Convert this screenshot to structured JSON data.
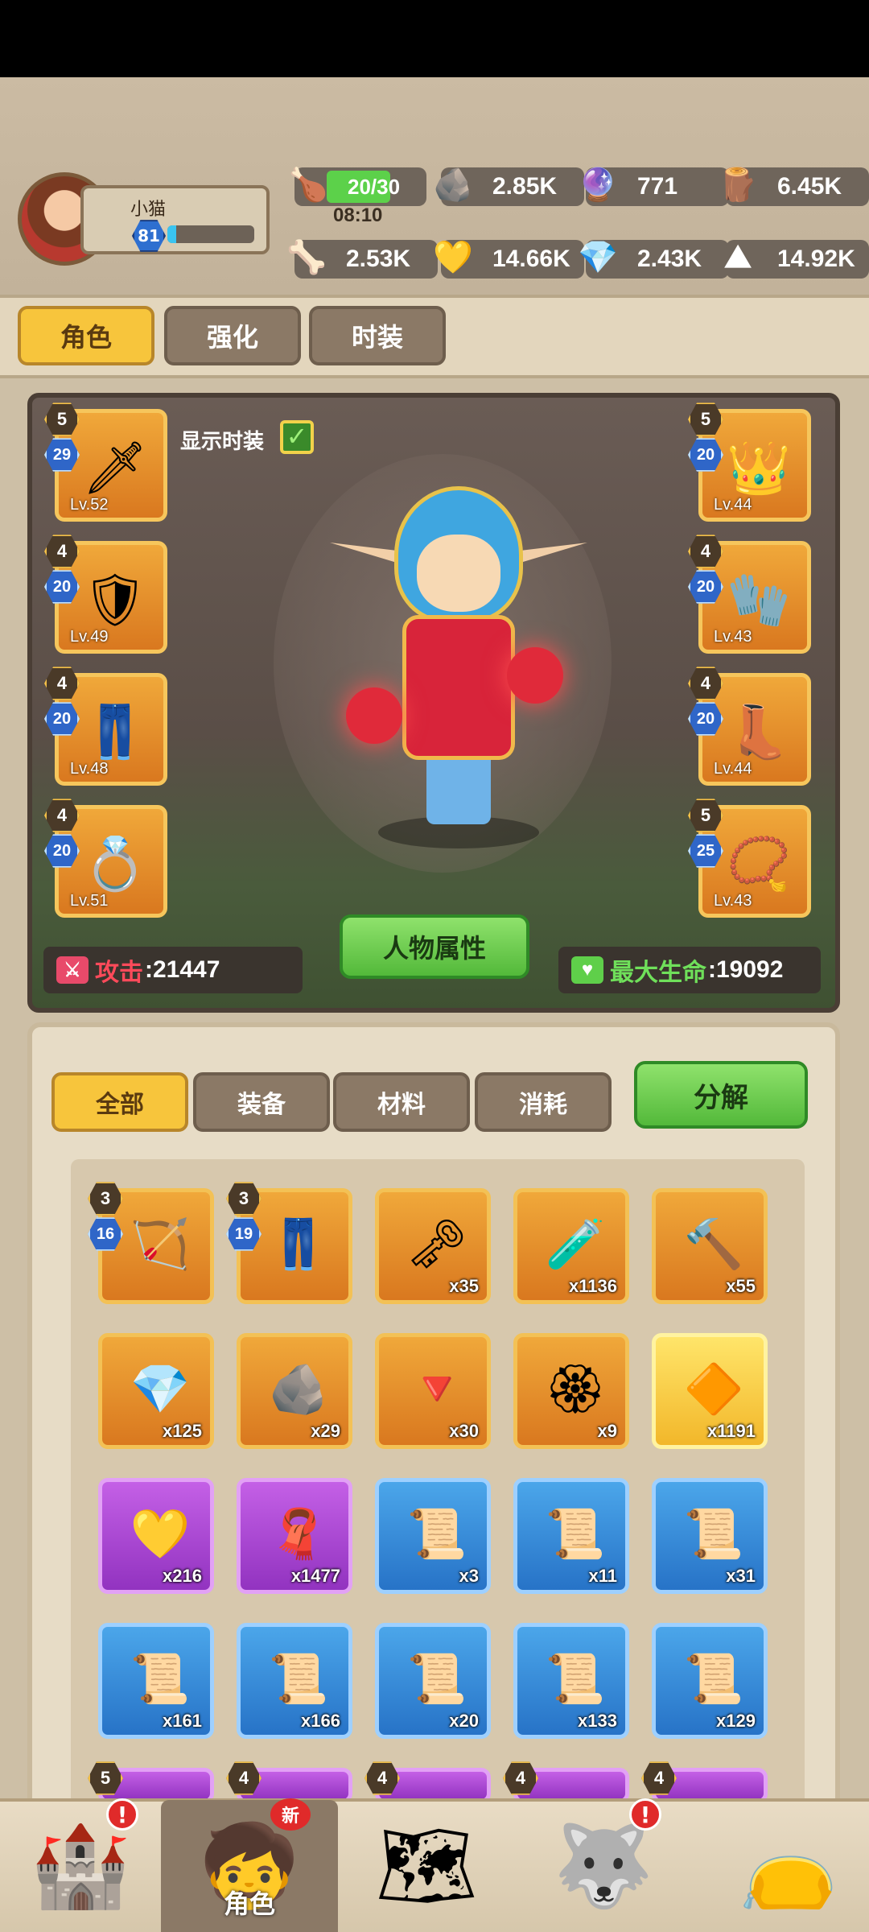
{
  "player": {
    "name": "小猫",
    "level": "81",
    "xp_fraction": 0.1
  },
  "resources": {
    "stamina": {
      "value": "20/30",
      "timer": "08:10",
      "fill": 0.66
    },
    "stone_plus": "2.85K",
    "purple_orb": "771",
    "wood": "6.45K",
    "bone": "2.53K",
    "gold_ore": "14.66K",
    "crystal": "2.43K",
    "iron": "14.92K"
  },
  "tabs": [
    "角色",
    "强化",
    "时装"
  ],
  "character": {
    "show_costume_label": "显示时装",
    "attack_label": "攻击",
    "attack_value": ":21447",
    "hp_label": "最大生命",
    "hp_value": ":19092",
    "attributes_button": "人物属性"
  },
  "equipment_left": [
    {
      "stars": "5",
      "level_badge": "29",
      "lv": "Lv.52",
      "icon": "weapon-icon"
    },
    {
      "stars": "4",
      "level_badge": "20",
      "lv": "Lv.49",
      "icon": "shoulder-armor-icon"
    },
    {
      "stars": "4",
      "level_badge": "20",
      "lv": "Lv.48",
      "icon": "leg-armor-icon"
    },
    {
      "stars": "4",
      "level_badge": "20",
      "lv": "Lv.51",
      "icon": "ring-icon"
    }
  ],
  "equipment_right": [
    {
      "stars": "5",
      "level_badge": "20",
      "lv": "Lv.44",
      "icon": "spiked-crown-icon"
    },
    {
      "stars": "4",
      "level_badge": "20",
      "lv": "Lv.43",
      "icon": "gauntlet-icon"
    },
    {
      "stars": "4",
      "level_badge": "20",
      "lv": "Lv.44",
      "icon": "boots-icon"
    },
    {
      "stars": "5",
      "level_badge": "25",
      "lv": "Lv.43",
      "icon": "necklace-icon"
    }
  ],
  "inventory": {
    "tabs": [
      "全部",
      "装备",
      "材料",
      "消耗"
    ],
    "decompose_button": "分解",
    "items": [
      {
        "color": "orange",
        "stars": "3",
        "level_badge": "16",
        "count": "",
        "icon": "crossbow-icon"
      },
      {
        "color": "orange",
        "stars": "3",
        "level_badge": "19",
        "count": "",
        "icon": "pants-icon"
      },
      {
        "color": "orange",
        "count": "x35",
        "icon": "key-wand-icon"
      },
      {
        "color": "orange",
        "count": "x1136",
        "icon": "potion-jar-icon"
      },
      {
        "color": "orange",
        "count": "x55",
        "icon": "hammer-icon"
      },
      {
        "color": "orange",
        "count": "x125",
        "icon": "blue-crystal-icon"
      },
      {
        "color": "orange",
        "count": "x29",
        "icon": "rune-stone-icon"
      },
      {
        "color": "orange",
        "count": "x30",
        "icon": "red-crystal-icon"
      },
      {
        "color": "orange",
        "count": "x9",
        "icon": "emblem-icon"
      },
      {
        "color": "gold",
        "count": "x1191",
        "icon": "gold-pile-icon"
      },
      {
        "color": "purple",
        "count": "x216",
        "icon": "gold-heart-icon"
      },
      {
        "color": "purple",
        "count": "x1477",
        "icon": "cloth-icon"
      },
      {
        "color": "blue",
        "count": "x3",
        "icon": "scroll-icon"
      },
      {
        "color": "blue",
        "count": "x11",
        "icon": "scroll-icon"
      },
      {
        "color": "blue",
        "count": "x31",
        "icon": "scroll-icon"
      },
      {
        "color": "blue",
        "count": "x161",
        "icon": "scroll-icon"
      },
      {
        "color": "blue",
        "count": "x166",
        "icon": "scroll-icon"
      },
      {
        "color": "blue",
        "count": "x20",
        "icon": "scroll-icon"
      },
      {
        "color": "blue",
        "count": "x133",
        "icon": "scroll-icon"
      },
      {
        "color": "blue",
        "count": "x129",
        "icon": "scroll-icon"
      }
    ],
    "partial_row_stars": [
      "5",
      "4",
      "4",
      "4",
      "4"
    ]
  },
  "bottom_nav": [
    {
      "label": "",
      "icon": "castle-icon",
      "alert": "!"
    },
    {
      "label": "角色",
      "icon": "hero-face-icon",
      "badge": "新"
    },
    {
      "label": "",
      "icon": "map-icon"
    },
    {
      "label": "",
      "icon": "wolf-pet-icon",
      "alert": "!"
    },
    {
      "label": "",
      "icon": "loot-bag-icon"
    }
  ]
}
